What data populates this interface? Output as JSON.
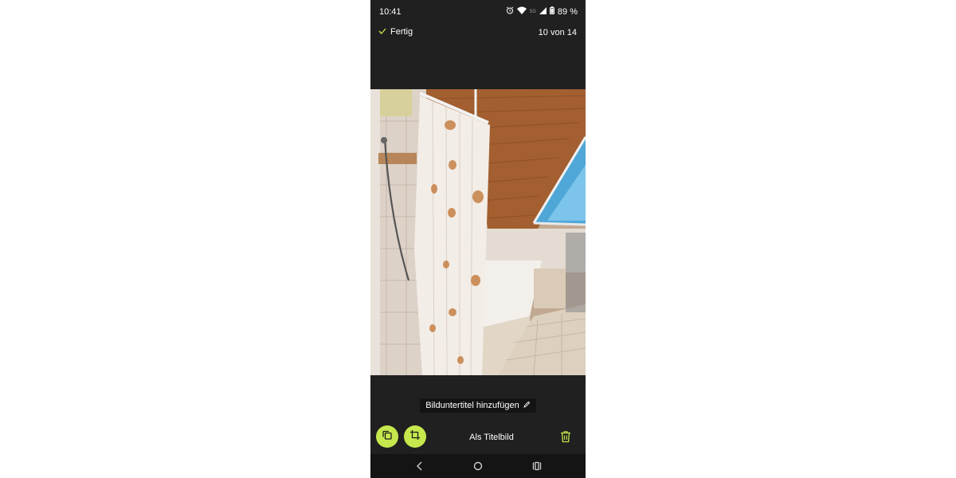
{
  "status_bar": {
    "time": "10:41",
    "network": "5G",
    "battery": "89 %",
    "icons": [
      "alarm-icon",
      "wifi-icon",
      "signal-icon",
      "battery-icon"
    ]
  },
  "header": {
    "done_label": "Fertig",
    "counter": "10 von 14"
  },
  "photo": {
    "icon": "bathroom-photo"
  },
  "caption": {
    "label": "Bilduntertitel hinzufügen"
  },
  "toolbar": {
    "cover_label": "Als Titelbild",
    "icons": [
      "copy-icon",
      "crop-icon",
      "trash-icon"
    ],
    "accent": "#c6e84d",
    "delete_color": "#c6e84d"
  },
  "nav_bar": {
    "icons": [
      "back-icon",
      "home-icon",
      "recents-icon"
    ]
  }
}
